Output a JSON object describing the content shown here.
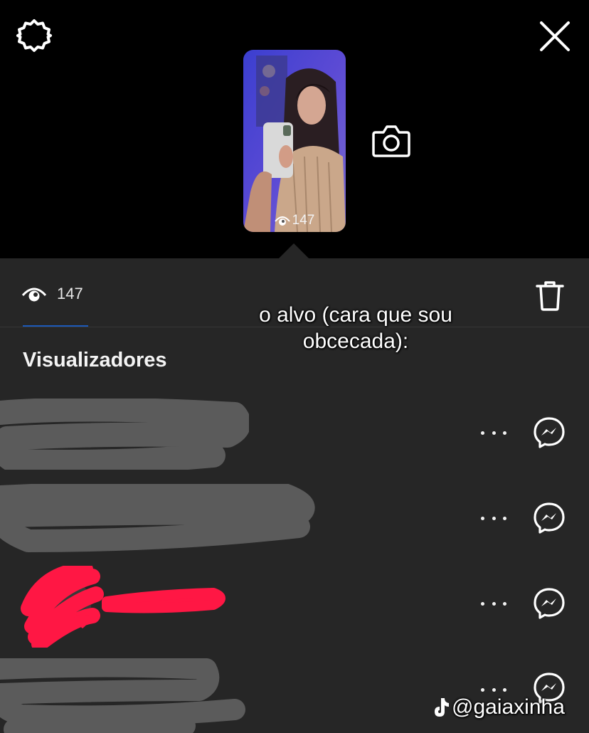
{
  "header": {
    "settings_icon": "gear-icon",
    "close_icon": "close-icon",
    "camera_icon": "camera-icon"
  },
  "story": {
    "thumbnail_views": "147",
    "background_color": "#4a43c8"
  },
  "stats": {
    "view_count": "147",
    "eye_icon": "eye-icon",
    "delete_icon": "trash-icon"
  },
  "overlay": {
    "caption_line1": "o alvo (cara que sou",
    "caption_line2": "obcecada):",
    "watermark": "@gaiaxinha"
  },
  "viewers": {
    "title": "Visualizadores",
    "row_actions": [
      "more-options",
      "messenger-reply"
    ]
  },
  "colors": {
    "sheet_background": "#262626",
    "redaction_gray": "#5b5b5b",
    "redaction_red": "#ff1744",
    "active_tab": "#1b58b8"
  }
}
